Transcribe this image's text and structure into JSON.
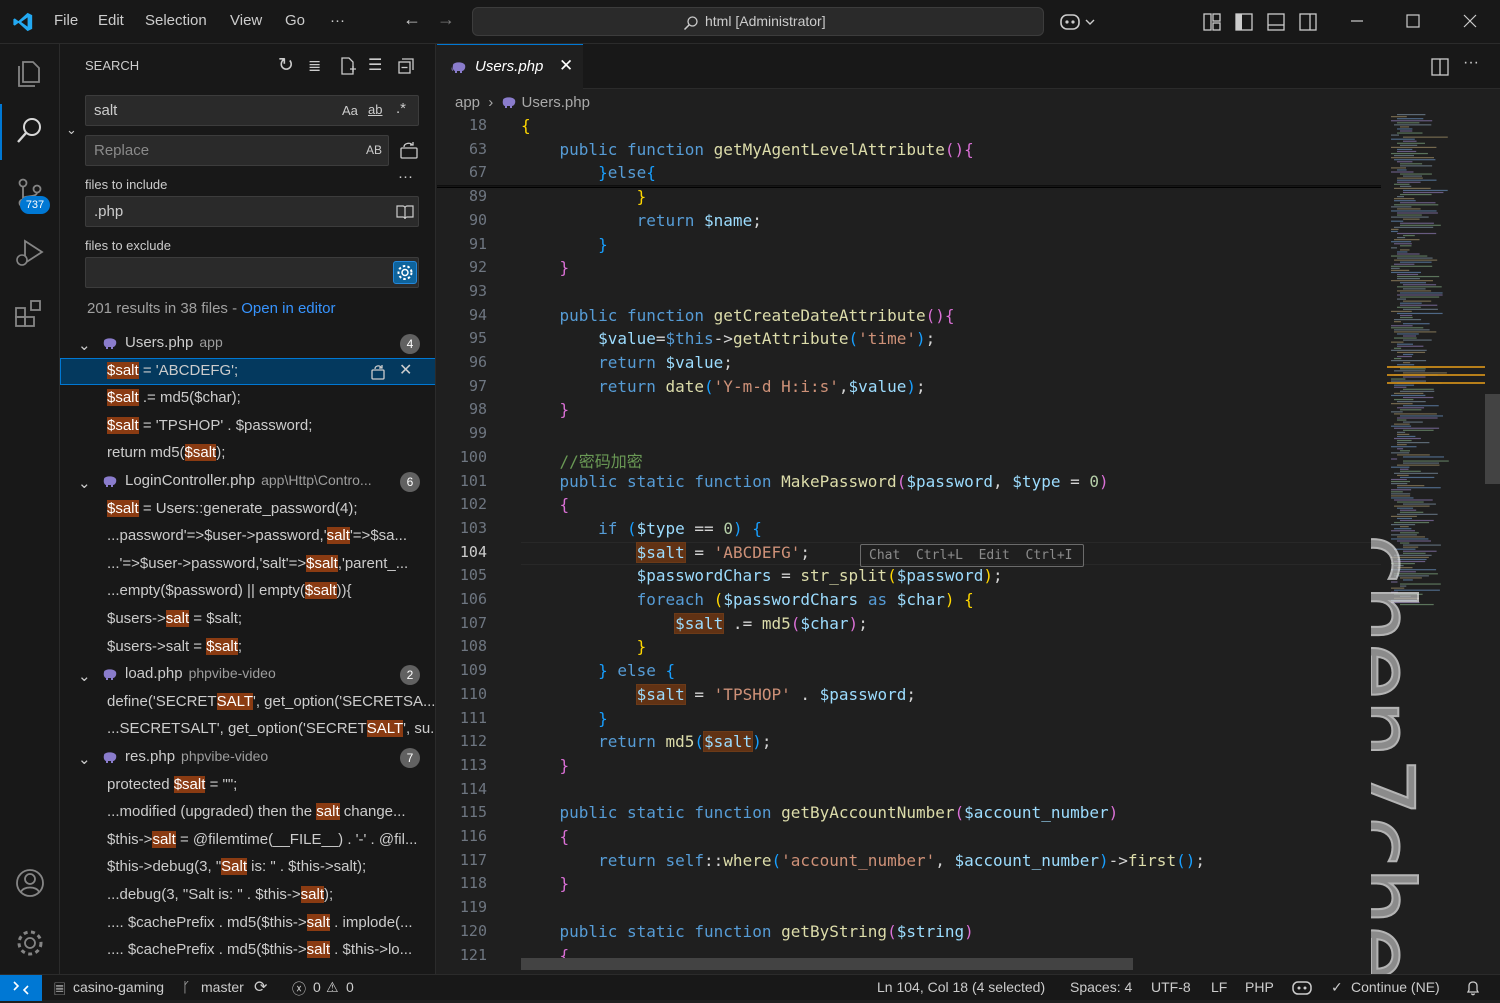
{
  "titlebar": {
    "menu": [
      "File",
      "Edit",
      "Selection",
      "View",
      "Go",
      "···"
    ],
    "command_center": "html [Administrator]"
  },
  "activity": {
    "scm_badge": "737"
  },
  "search": {
    "header": "SEARCH",
    "query": "salt",
    "replace_placeholder": "Replace",
    "match_case": "Aa",
    "whole_word": "ab",
    "regex": ".*",
    "preserve_case": "AB",
    "include_label": "files to include",
    "include_value": ".php",
    "exclude_label": "files to exclude",
    "exclude_value": "",
    "summary": "201 results in 38 files - ",
    "open_in_editor": "Open in editor"
  },
  "results": [
    {
      "type": "file",
      "name": "Users.php",
      "dir": "app",
      "count": "4"
    },
    {
      "type": "match",
      "pre": "",
      "hl": "$salt",
      "post": " = 'ABCDEFG';",
      "selected": true
    },
    {
      "type": "match",
      "pre": "",
      "hl": "$salt",
      "post": " .= md5($char);"
    },
    {
      "type": "match",
      "pre": "",
      "hl": "$salt",
      "post": " = 'TPSHOP' . $password;"
    },
    {
      "type": "match",
      "pre": "return md5(",
      "hl": "$salt",
      "post": ");"
    },
    {
      "type": "file",
      "name": "LoginController.php",
      "dir": "app\\Http\\Contro...",
      "count": "6"
    },
    {
      "type": "match",
      "pre": "",
      "hl": "$salt",
      "post": " = Users::generate_password(4);"
    },
    {
      "type": "match",
      "pre": "...password'=>$user->password,'",
      "hl": "salt",
      "post": "'=>$sa..."
    },
    {
      "type": "match",
      "pre": "...'=>$user->password,'salt'=>",
      "hl": "$salt",
      "post": ",'parent_..."
    },
    {
      "type": "match",
      "pre": "...empty($password) || empty(",
      "hl": "$salt",
      "post": ")){"
    },
    {
      "type": "match",
      "pre": "$users->",
      "hl": "salt",
      "post": " = $salt;"
    },
    {
      "type": "match",
      "pre": "$users->salt = ",
      "hl": "$salt",
      "post": ";"
    },
    {
      "type": "file",
      "name": "load.php",
      "dir": "phpvibe-video",
      "count": "2"
    },
    {
      "type": "match",
      "pre": "define('SECRET",
      "hl": "SALT",
      "post": "', get_option('SECRETSA..."
    },
    {
      "type": "match",
      "pre": "...SECRETSALT', get_option('SECRET",
      "hl": "SALT",
      "post": "', su..."
    },
    {
      "type": "file",
      "name": "res.php",
      "dir": "phpvibe-video",
      "count": "7"
    },
    {
      "type": "match",
      "pre": "protected ",
      "hl": "$salt",
      "post": " = \"\";"
    },
    {
      "type": "match",
      "pre": "...modified (upgraded) then the ",
      "hl": "salt",
      "post": " change..."
    },
    {
      "type": "match",
      "pre": "$this->",
      "hl": "salt",
      "post": " = @filemtime(__FILE__) . '-' . @fil..."
    },
    {
      "type": "match",
      "pre": "$this->debug(3, \"",
      "hl": "Salt",
      "post": " is: \" . $this->salt);"
    },
    {
      "type": "match",
      "pre": "...debug(3, \"Salt is: \" . $this->",
      "hl": "salt",
      "post": ");"
    },
    {
      "type": "match",
      "pre": ".... $cachePrefix . md5($this->",
      "hl": "salt",
      "post": " . implode(..."
    },
    {
      "type": "match",
      "pre": ".... $cachePrefix . md5($this->",
      "hl": "salt",
      "post": " . $this->lo..."
    }
  ],
  "editor": {
    "tab": "Users.php",
    "crumb_folder": "app",
    "crumb_file": "Users.php",
    "inline_hint": "Chat  Ctrl+L  Edit  Ctrl+I",
    "watermark": "chen7chen"
  },
  "code_lines": [
    {
      "n": "18",
      "h": "<span class=\"br\">{</span>"
    },
    {
      "n": "63",
      "h": "    <span class=\"kw\">public function</span> <span class=\"fn\">getMyAgentLevelAttribute</span><span class=\"br2\">()</span><span class=\"br2\">{</span>"
    },
    {
      "n": "67",
      "h": "        <span class=\"br3\">}</span><span class=\"kw\">else</span><span class=\"br3\">{</span>"
    },
    {
      "n": "89",
      "h": "            <span class=\"br\">}</span>"
    },
    {
      "n": "90",
      "h": "            <span class=\"kw\">return</span> <span class=\"vr\">$name</span>;"
    },
    {
      "n": "91",
      "h": "        <span class=\"br3\">}</span>"
    },
    {
      "n": "92",
      "h": "    <span class=\"br2\">}</span>"
    },
    {
      "n": "93",
      "h": ""
    },
    {
      "n": "94",
      "h": "    <span class=\"kw\">public function</span> <span class=\"fn\">getCreateDateAttribute</span><span class=\"br2\">()</span><span class=\"br2\">{</span>"
    },
    {
      "n": "95",
      "h": "        <span class=\"vr\">$value</span>=<span class=\"kw\">$this</span>-><span class=\"fn\">getAttribute</span><span class=\"br3\">(</span><span class=\"st\">'time'</span><span class=\"br3\">)</span>;"
    },
    {
      "n": "96",
      "h": "        <span class=\"kw\">return</span> <span class=\"vr\">$value</span>;"
    },
    {
      "n": "97",
      "h": "        <span class=\"kw\">return</span> <span class=\"fn\">date</span><span class=\"br3\">(</span><span class=\"st\">'Y-m-d H:i:s'</span>,<span class=\"vr\">$value</span><span class=\"br3\">)</span>;"
    },
    {
      "n": "98",
      "h": "    <span class=\"br2\">}</span>"
    },
    {
      "n": "99",
      "h": ""
    },
    {
      "n": "100",
      "h": "    <span class=\"cm\">//密码加密</span>"
    },
    {
      "n": "101",
      "h": "    <span class=\"kw\">public static function</span> <span class=\"fn\">MakePassword</span><span class=\"br2\">(</span><span class=\"vr\">$password</span>, <span class=\"vr\">$type</span> = <span class=\"nm\">0</span><span class=\"br2\">)</span>"
    },
    {
      "n": "102",
      "h": "    <span class=\"br2\">{</span>"
    },
    {
      "n": "103",
      "h": "        <span class=\"kw\">if</span> <span class=\"br3\">(</span><span class=\"vr\">$type</span> == <span class=\"nm\">0</span><span class=\"br3\">)</span> <span class=\"br3\">{</span>"
    },
    {
      "n": "104",
      "h": "            <span class=\"vr shl\">$salt</span> = <span class=\"st\">'ABCDEFG'</span>;",
      "cur": true
    },
    {
      "n": "105",
      "h": "            <span class=\"vr\">$passwordChars</span> = <span class=\"fn\">str_split</span><span class=\"br\">(</span><span class=\"vr\">$password</span><span class=\"br\">)</span>;"
    },
    {
      "n": "106",
      "h": "            <span class=\"kw\">foreach</span> <span class=\"br\">(</span><span class=\"vr\">$passwordChars</span> <span class=\"kw\">as</span> <span class=\"vr\">$char</span><span class=\"br\">)</span> <span class=\"br\">{</span>"
    },
    {
      "n": "107",
      "h": "                <span class=\"vr shl\">$salt</span> .= <span class=\"fn\">md5</span><span class=\"br2\">(</span><span class=\"vr\">$char</span><span class=\"br2\">)</span>;"
    },
    {
      "n": "108",
      "h": "            <span class=\"br\">}</span>"
    },
    {
      "n": "109",
      "h": "        <span class=\"br3\">}</span> <span class=\"kw\">else</span> <span class=\"br3\">{</span>"
    },
    {
      "n": "110",
      "h": "            <span class=\"vr shl\">$salt</span> = <span class=\"st\">'TPSHOP'</span> . <span class=\"vr\">$password</span>;"
    },
    {
      "n": "111",
      "h": "        <span class=\"br3\">}</span>"
    },
    {
      "n": "112",
      "h": "        <span class=\"kw\">return</span> <span class=\"fn\">md5</span><span class=\"br3\">(</span><span class=\"vr shl\">$salt</span><span class=\"br3\">)</span>;"
    },
    {
      "n": "113",
      "h": "    <span class=\"br2\">}</span>"
    },
    {
      "n": "114",
      "h": ""
    },
    {
      "n": "115",
      "h": "    <span class=\"kw\">public static function</span> <span class=\"fn\">getByAccountNumber</span><span class=\"br2\">(</span><span class=\"vr\">$account_number</span><span class=\"br2\">)</span>"
    },
    {
      "n": "116",
      "h": "    <span class=\"br2\">{</span>"
    },
    {
      "n": "117",
      "h": "        <span class=\"kw\">return</span> <span class=\"kw\">self</span>::<span class=\"fn\">where</span><span class=\"br3\">(</span><span class=\"st\">'account_number'</span>, <span class=\"vr\">$account_number</span><span class=\"br3\">)</span>-><span class=\"fn\">first</span><span class=\"br3\">()</span>;"
    },
    {
      "n": "118",
      "h": "    <span class=\"br2\">}</span>"
    },
    {
      "n": "119",
      "h": ""
    },
    {
      "n": "120",
      "h": "    <span class=\"kw\">public static function</span> <span class=\"fn\">getByString</span><span class=\"br2\">(</span><span class=\"vr\">$string</span><span class=\"br2\">)</span>"
    },
    {
      "n": "121",
      "h": "    <span class=\"br2\">{</span>"
    }
  ],
  "status": {
    "branch_host": "casino-gaming",
    "branch": "master",
    "errors": "0",
    "warnings": "0",
    "position": "Ln 104, Col 18 (4 selected)",
    "spaces": "Spaces: 4",
    "encoding": "UTF-8",
    "eol": "LF",
    "language": "PHP",
    "continue": "Continue (NE)"
  },
  "colors": {
    "accent": "#0078d4",
    "match_highlight": "#8a3b12",
    "editor_bg": "#1f1f1f",
    "panel_bg": "#181818"
  }
}
